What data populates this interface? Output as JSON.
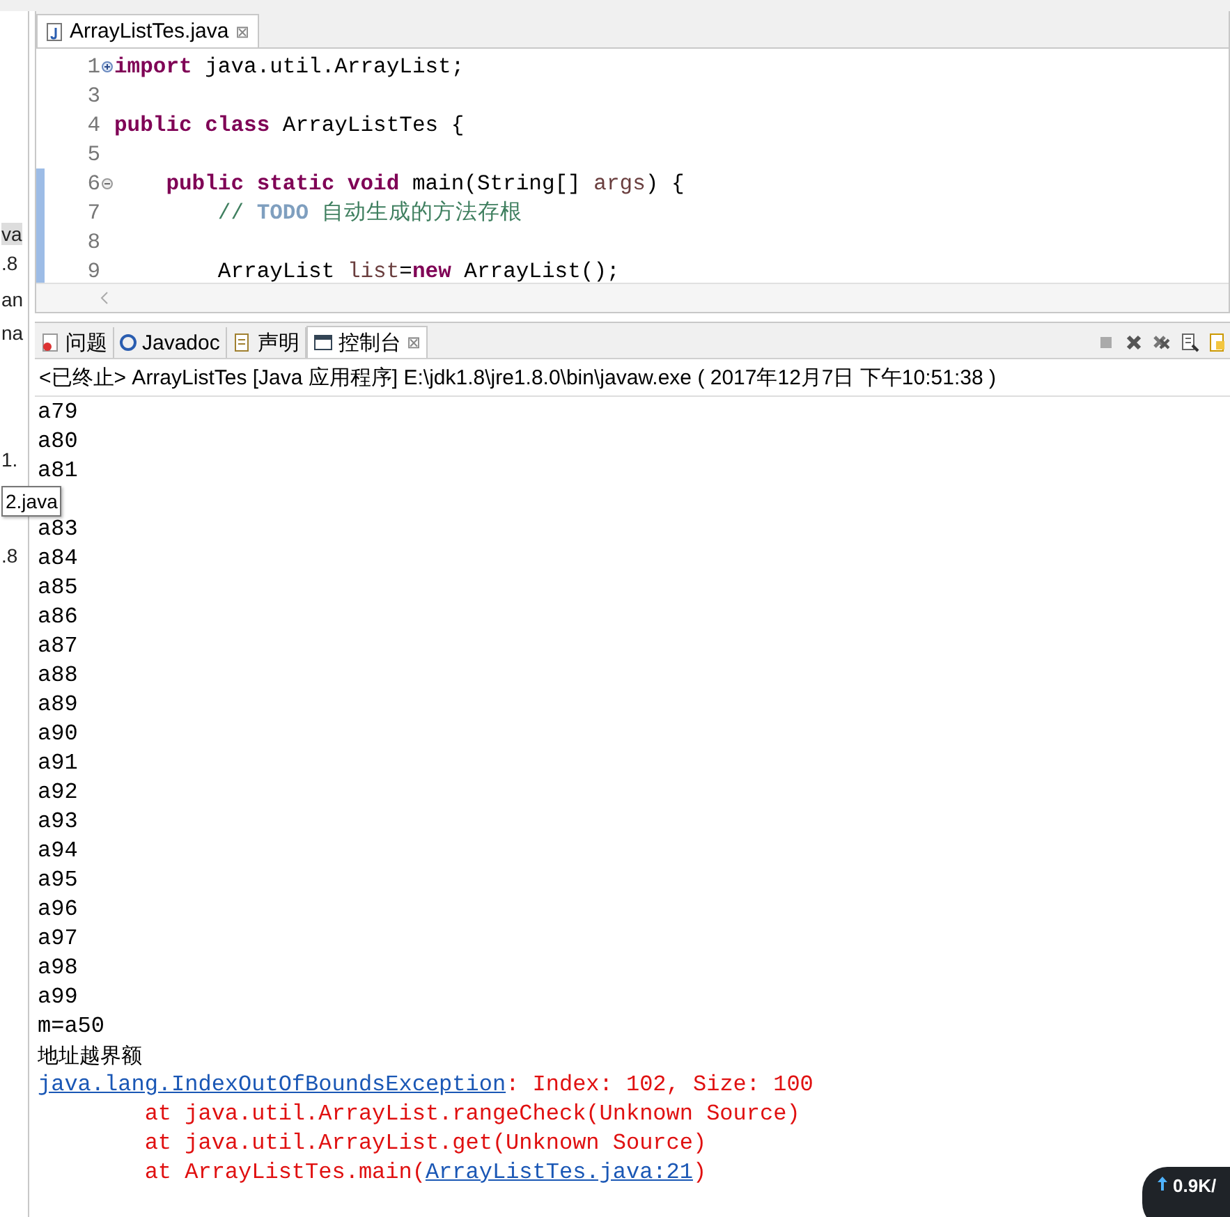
{
  "side_fragments": [
    {
      "text": "va",
      "selected": true
    },
    {
      "text": ".8",
      "selected": false
    },
    {
      "text": "an",
      "selected": false
    },
    {
      "text": "na",
      "selected": false
    },
    {
      "text": "1.",
      "selected": false
    },
    {
      "text": ".8",
      "selected": false
    }
  ],
  "editor": {
    "tab": {
      "label": "ArrayListTes.java",
      "close": "⊠"
    },
    "lines": [
      {
        "number": "1",
        "segments": [
          {
            "kind": "keyword",
            "text": "import"
          },
          {
            "kind": "plain",
            "text": " java.util.ArrayList;"
          }
        ]
      },
      {
        "number": "3"
      },
      {
        "number": "4",
        "segments": [
          {
            "kind": "keyword",
            "text": "public class"
          },
          {
            "kind": "plain",
            "text": " ArrayListTes {"
          }
        ]
      },
      {
        "number": "5"
      },
      {
        "number": "6",
        "segments": [
          {
            "kind": "keyword",
            "text": "    public static void"
          },
          {
            "kind": "plain",
            "text": " main(String[] "
          },
          {
            "kind": "param",
            "text": "args"
          },
          {
            "kind": "plain",
            "text": ") {"
          }
        ]
      },
      {
        "number": "7",
        "segments": [
          {
            "kind": "comment",
            "text": "        // "
          },
          {
            "kind": "todo",
            "text": "TODO"
          },
          {
            "kind": "comment",
            "text": " 自动生成的方法存根"
          }
        ]
      },
      {
        "number": "8"
      },
      {
        "number": "9",
        "segments": [
          {
            "kind": "plain",
            "text": "        ArrayList "
          },
          {
            "kind": "param",
            "text": "list"
          },
          {
            "kind": "plain",
            "text": "="
          },
          {
            "kind": "keyword",
            "text": "new"
          },
          {
            "kind": "plain",
            "text": " ArrayList();"
          }
        ]
      }
    ]
  },
  "console": {
    "tabs": [
      {
        "label": "问题",
        "selected": false
      },
      {
        "label": "Javadoc",
        "selected": false
      },
      {
        "label": "声明",
        "selected": false
      },
      {
        "label": "控制台",
        "selected": true,
        "close": "⊠"
      }
    ],
    "header": "<已终止> ArrayListTes [Java 应用程序] E:\\jdk1.8\\jre1.8.0\\bin\\javaw.exe ( 2017年12月7日 下午10:51:38 )",
    "lines": [
      {
        "segments": [
          {
            "kind": "out",
            "text": "a79"
          }
        ]
      },
      {
        "segments": [
          {
            "kind": "out",
            "text": "a80"
          }
        ]
      },
      {
        "segments": [
          {
            "kind": "out",
            "text": "a81"
          }
        ]
      },
      {
        "tooltip": "2.java"
      },
      {
        "segments": [
          {
            "kind": "out",
            "text": "a83"
          }
        ]
      },
      {
        "segments": [
          {
            "kind": "out",
            "text": "a84"
          }
        ]
      },
      {
        "segments": [
          {
            "kind": "out",
            "text": "a85"
          }
        ]
      },
      {
        "segments": [
          {
            "kind": "out",
            "text": "a86"
          }
        ]
      },
      {
        "segments": [
          {
            "kind": "out",
            "text": "a87"
          }
        ]
      },
      {
        "segments": [
          {
            "kind": "out",
            "text": "a88"
          }
        ]
      },
      {
        "segments": [
          {
            "kind": "out",
            "text": "a89"
          }
        ]
      },
      {
        "segments": [
          {
            "kind": "out",
            "text": "a90"
          }
        ]
      },
      {
        "segments": [
          {
            "kind": "out",
            "text": "a91"
          }
        ]
      },
      {
        "segments": [
          {
            "kind": "out",
            "text": "a92"
          }
        ]
      },
      {
        "segments": [
          {
            "kind": "out",
            "text": "a93"
          }
        ]
      },
      {
        "segments": [
          {
            "kind": "out",
            "text": "a94"
          }
        ]
      },
      {
        "segments": [
          {
            "kind": "out",
            "text": "a95"
          }
        ]
      },
      {
        "segments": [
          {
            "kind": "out",
            "text": "a96"
          }
        ]
      },
      {
        "segments": [
          {
            "kind": "out",
            "text": "a97"
          }
        ]
      },
      {
        "segments": [
          {
            "kind": "out",
            "text": "a98"
          }
        ]
      },
      {
        "segments": [
          {
            "kind": "out",
            "text": "a99"
          }
        ]
      },
      {
        "segments": [
          {
            "kind": "out",
            "text": "m=a50"
          }
        ]
      },
      {
        "segments": [
          {
            "kind": "out",
            "text": "地址越界额"
          }
        ]
      },
      {
        "segments": [
          {
            "kind": "link",
            "text": "java.lang.IndexOutOfBoundsException"
          },
          {
            "kind": "err",
            "text": ": Index: 102, Size: 100"
          }
        ]
      },
      {
        "segments": [
          {
            "kind": "err",
            "text": "        at java.util.ArrayList.rangeCheck(Unknown Source)"
          }
        ]
      },
      {
        "segments": [
          {
            "kind": "err",
            "text": "        at java.util.ArrayList.get(Unknown Source)"
          }
        ]
      },
      {
        "segments": [
          {
            "kind": "err",
            "text": "        at ArrayListTes.main("
          },
          {
            "kind": "link",
            "text": "ArrayListTes.java:21"
          },
          {
            "kind": "err",
            "text": ")"
          }
        ]
      }
    ]
  },
  "network_widget": {
    "upload": "0.9K/"
  }
}
